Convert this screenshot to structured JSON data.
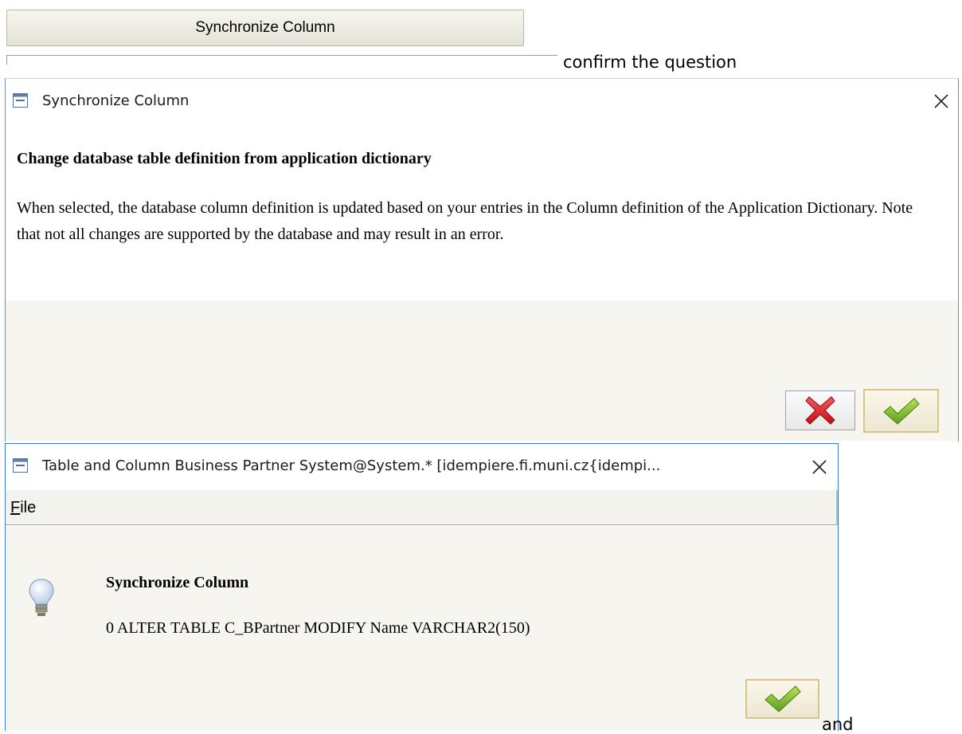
{
  "top": {
    "button_label": "Synchronize Column",
    "note_confirm": "confirm the question",
    "note_and": "and"
  },
  "dialog1": {
    "title": "Synchronize Column",
    "heading": "Change database table definition from application dictionary",
    "body": "When selected, the database column definition is updated based on your entries in the Column definition of the Application Dictionary. Note that not all changes are supported by the database and may result in an error.",
    "buttons": {
      "cancel_icon": "red-x-icon",
      "ok_icon": "green-check-icon"
    }
  },
  "dialog2": {
    "title": "Table and Column  Business Partner   System@System.* [idempiere.fi.muni.cz{idempi...",
    "menu": {
      "file_label": "File",
      "file_mnemonic": "F"
    },
    "message_title": "Synchronize Column",
    "message_body": "0 ALTER TABLE C_BPartner MODIFY Name VARCHAR2(150)",
    "icon": "lightbulb-icon"
  },
  "colors": {
    "accent_border": "#3b7fd4",
    "footer_bg": "#f7f5ef",
    "cancel_red": "#d6161b",
    "ok_green": "#7fbf2a"
  }
}
